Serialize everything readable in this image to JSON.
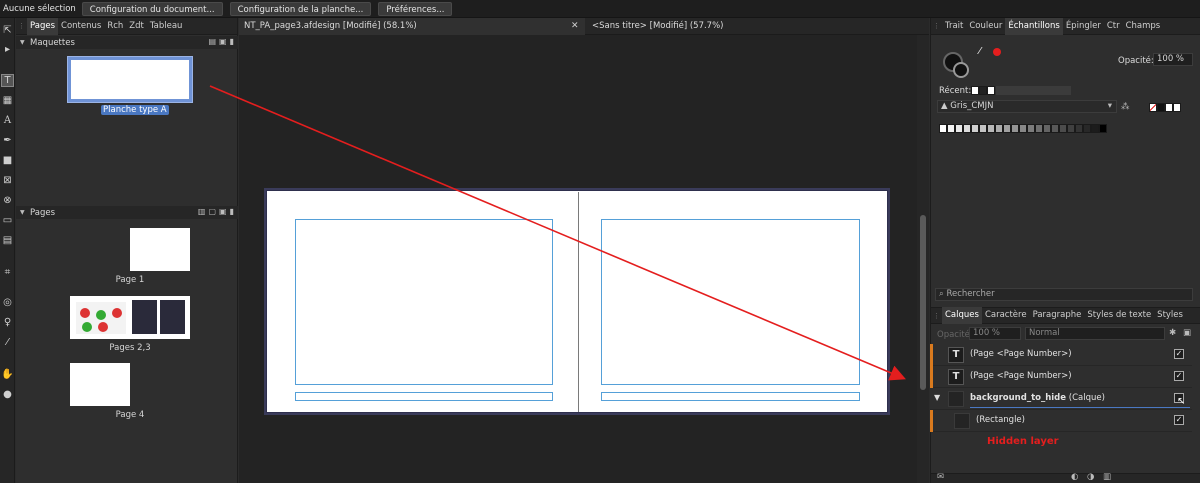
{
  "context_toolbar": {
    "status": "Aucune sélection",
    "buttons": [
      "Configuration du document...",
      "Configuration de la planche...",
      "Préférences..."
    ]
  },
  "left_panel": {
    "tabs": [
      "Pages",
      "Contenus",
      "Rch",
      "Zdt",
      "Tableau"
    ],
    "masters_header": "Maquettes",
    "master_label": "Planche type A",
    "pages_header": "Pages",
    "pages": [
      {
        "label": "Page 1"
      },
      {
        "label": "Pages 2,3"
      },
      {
        "label": "Page 4"
      }
    ]
  },
  "document_tabs": [
    {
      "label": "NT_PA_page3.afdesign [Modifié] (58.1%)",
      "active": true
    },
    {
      "label": "<Sans titre> [Modifié] (57.7%)",
      "active": false
    }
  ],
  "right_panel": {
    "tabs": [
      "Trait",
      "Couleur",
      "Échantillons",
      "Épingler",
      "Ctr",
      "Champs"
    ],
    "active_tab": "Échantillons",
    "opacity_label": "Opacité:",
    "opacity_value": "100 %",
    "recent_label": "Récent:",
    "palette": "Gris_CMJN",
    "search_placeholder": "Rechercher",
    "colors": {
      "accent_red": "#e41e1e",
      "layer_marker": "#d97a1e",
      "frame_blue": "#55a0d8"
    }
  },
  "layers_panel": {
    "tabs": [
      "Calques",
      "Caractère",
      "Paragraphe",
      "Styles de texte",
      "Styles"
    ],
    "active_tab": "Calques",
    "opacity_label": "Opacité:",
    "opacity_value": "100 %",
    "blend_mode": "Normal",
    "layers": [
      {
        "name": "(Page <Page Number>)",
        "type": "",
        "checked": true
      },
      {
        "name": "(Page <Page Number>)",
        "type": "",
        "checked": true
      },
      {
        "name": "background_to_hide",
        "type": "(Calque)",
        "checked": false
      },
      {
        "name": "(Rectangle)",
        "type": "",
        "checked": true
      }
    ]
  },
  "annotation": {
    "hidden_layer_note": "Hidden layer"
  }
}
